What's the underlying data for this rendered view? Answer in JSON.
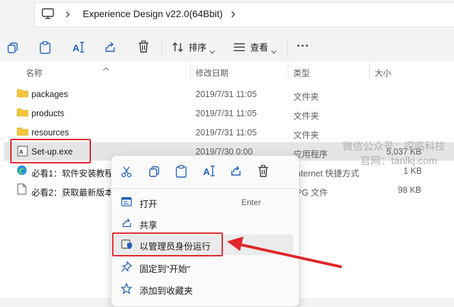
{
  "address": {
    "path": "Experience Design v22.0(64Bbit)"
  },
  "toolbar": {
    "sort_label": "排序",
    "view_label": "查看",
    "more_label": "···"
  },
  "columns": {
    "name": "名称",
    "modified": "修改日期",
    "type": "类型",
    "size": "大小"
  },
  "rows": [
    {
      "name": "packages",
      "modified": "2019/7/31 11:05",
      "type": "文件夹",
      "size": ""
    },
    {
      "name": "products",
      "modified": "2019/7/31 11:05",
      "type": "文件夹",
      "size": ""
    },
    {
      "name": "resources",
      "modified": "2019/7/31 11:05",
      "type": "文件夹",
      "size": ""
    },
    {
      "name": "Set-up.exe",
      "modified": "2019/7/30 0:00",
      "type": "应用程序",
      "size": "5,037 KB"
    },
    {
      "name": "必看1：软件安装教程",
      "modified": "",
      "type": "nternet 快捷方式",
      "size": "1 KB"
    },
    {
      "name": "必看2：获取最新版本",
      "modified": "",
      "type": "PG 文件",
      "size": "98 KB"
    }
  ],
  "menu": {
    "open": "打开",
    "open_shortcut": "Enter",
    "share": "共享",
    "run_as_admin": "以管理员身份运行",
    "pin_start": "固定到\"开始\"",
    "add_favorites": "添加到收藏夹"
  },
  "watermark": {
    "line1": "微信公众号：探临科技",
    "line2": "官网：tanlkj.com"
  },
  "colors": {
    "highlight_red": "#e0262b",
    "folder_yellow": "#f4c63d"
  }
}
